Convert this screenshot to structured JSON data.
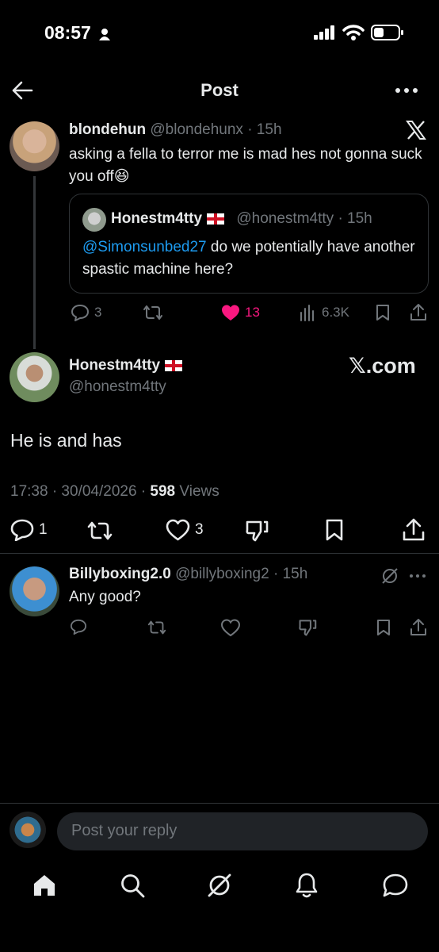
{
  "status": {
    "time": "08:57"
  },
  "header": {
    "title": "Post"
  },
  "post1": {
    "name": "blondehun",
    "handle": "@blondehunx",
    "time": "· 15h",
    "text": "asking a fella to terror me is mad hes not gonna suck you off😆",
    "quote": {
      "name": "Honestm4tty",
      "handle": "@honestm4tty",
      "time": "· 15h",
      "mention": "@Simonsunbed27",
      "text": " do we potentially have another spastic machine here?"
    },
    "replies": "3",
    "likes": "13",
    "views": "6.3K"
  },
  "main": {
    "name": "Honestm4tty",
    "handle": "@honestm4tty",
    "watermark": "𝕏.com",
    "text": "He is and has",
    "meta_time": "17:38 · 30/04/2026 · ",
    "meta_views": "598",
    "meta_views_label": " Views",
    "replies": "1",
    "likes": "3"
  },
  "reply": {
    "name": "Billyboxing2.0",
    "handle": "@billyboxing2",
    "time": "· 15h",
    "text": "Any good?"
  },
  "composer": {
    "placeholder": "Post your reply"
  },
  "colors": {
    "accent": "#1d9bf0",
    "like": "#f91880",
    "background": "#000000"
  }
}
